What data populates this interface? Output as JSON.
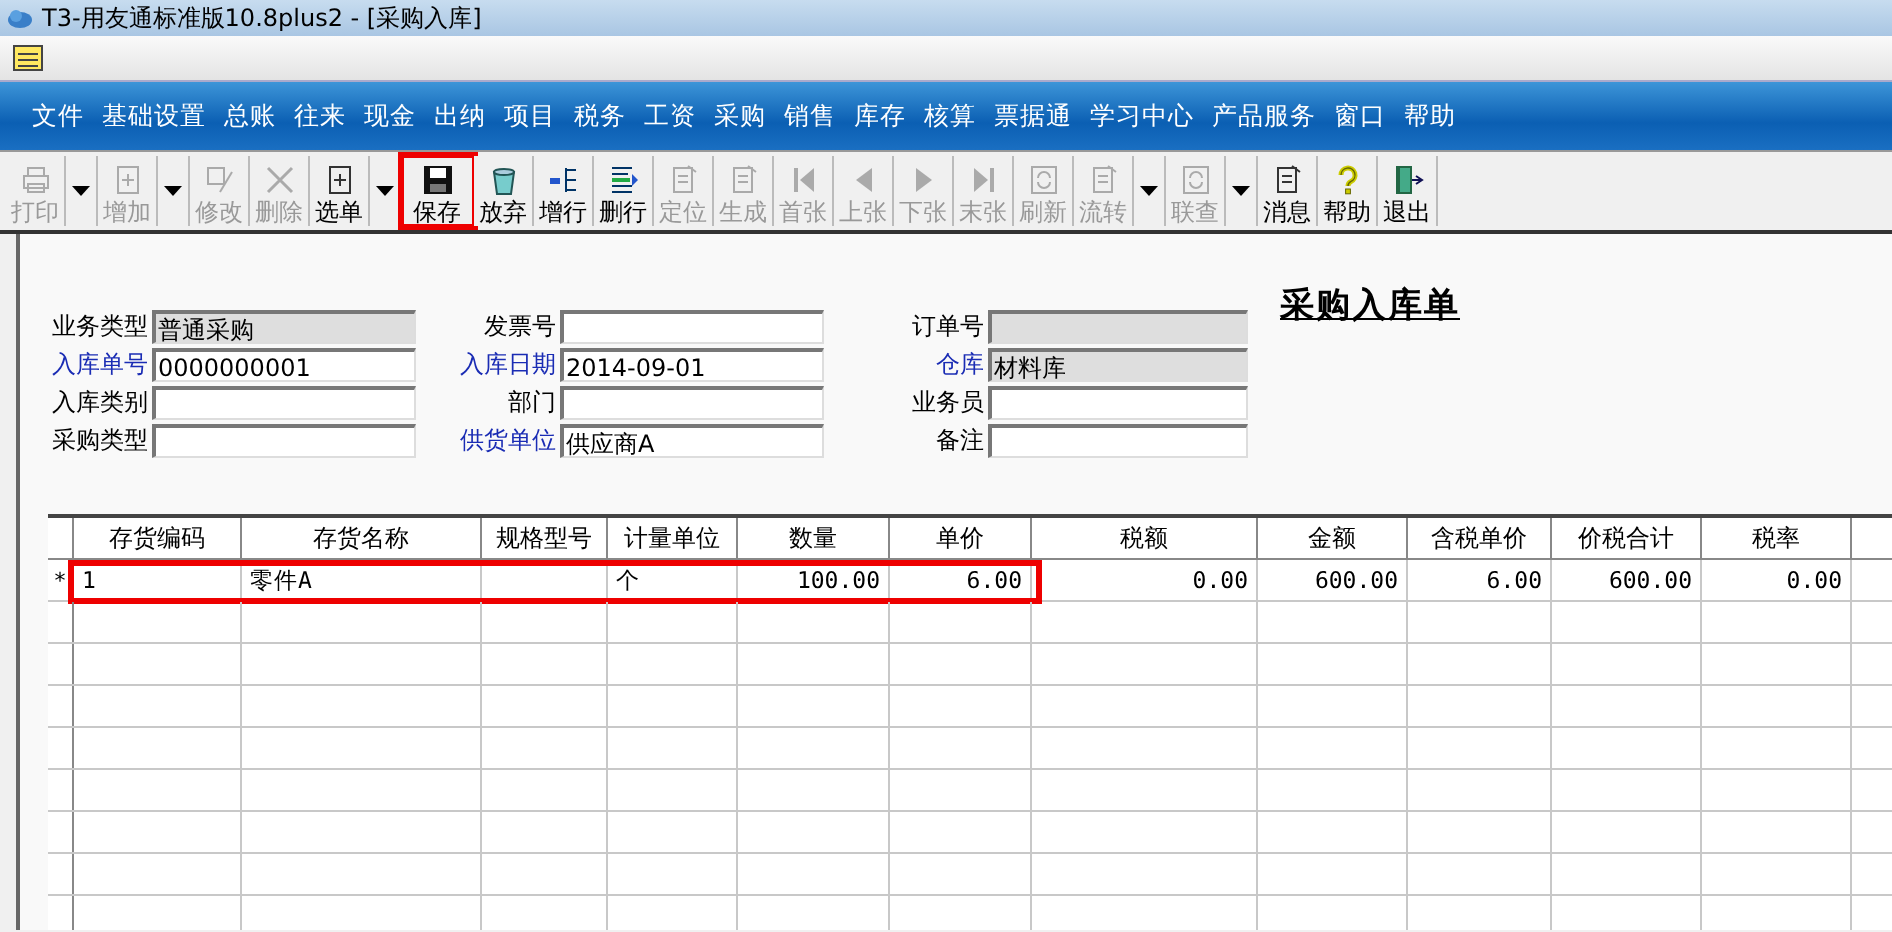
{
  "window": {
    "title": "T3-用友通标准版10.8plus2 - [采购入库]"
  },
  "menu": [
    "文件",
    "基础设置",
    "总账",
    "往来",
    "现金",
    "出纳",
    "项目",
    "税务",
    "工资",
    "采购",
    "销售",
    "库存",
    "核算",
    "票据通",
    "学习中心",
    "产品服务",
    "窗口",
    "帮助"
  ],
  "toolbar": [
    {
      "kind": "button",
      "label": "打印",
      "disabled": true,
      "highlighted": false
    },
    {
      "kind": "dropdown",
      "disabled": false
    },
    {
      "kind": "button",
      "label": "增加",
      "disabled": true,
      "highlighted": false
    },
    {
      "kind": "dropdown",
      "disabled": false
    },
    {
      "kind": "button",
      "label": "修改",
      "disabled": true,
      "highlighted": false
    },
    {
      "kind": "button",
      "label": "删除",
      "disabled": true,
      "highlighted": false
    },
    {
      "kind": "button",
      "label": "选单",
      "disabled": false,
      "highlighted": false
    },
    {
      "kind": "dropdown",
      "disabled": false
    },
    {
      "kind": "button",
      "label": "保存",
      "disabled": false,
      "highlighted": true
    },
    {
      "kind": "button",
      "label": "放弃",
      "disabled": false,
      "highlighted": false
    },
    {
      "kind": "button",
      "label": "增行",
      "disabled": false,
      "highlighted": false
    },
    {
      "kind": "button",
      "label": "删行",
      "disabled": false,
      "highlighted": false
    },
    {
      "kind": "button",
      "label": "定位",
      "disabled": true,
      "highlighted": false
    },
    {
      "kind": "button",
      "label": "生成",
      "disabled": true,
      "highlighted": false
    },
    {
      "kind": "button",
      "label": "首张",
      "disabled": true,
      "highlighted": false
    },
    {
      "kind": "button",
      "label": "上张",
      "disabled": true,
      "highlighted": false
    },
    {
      "kind": "button",
      "label": "下张",
      "disabled": true,
      "highlighted": false
    },
    {
      "kind": "button",
      "label": "末张",
      "disabled": true,
      "highlighted": false
    },
    {
      "kind": "button",
      "label": "刷新",
      "disabled": true,
      "highlighted": false
    },
    {
      "kind": "button",
      "label": "流转",
      "disabled": true,
      "highlighted": false
    },
    {
      "kind": "dropdown",
      "disabled": false
    },
    {
      "kind": "button",
      "label": "联查",
      "disabled": true,
      "highlighted": false
    },
    {
      "kind": "dropdown",
      "disabled": false
    },
    {
      "kind": "button",
      "label": "消息",
      "disabled": false,
      "highlighted": false
    },
    {
      "kind": "button",
      "label": "帮助",
      "disabled": false,
      "highlighted": false
    },
    {
      "kind": "button",
      "label": "退出",
      "disabled": false,
      "highlighted": false
    }
  ],
  "form": {
    "title": "采购入库单",
    "fields": [
      {
        "label": "业务类型",
        "value": "普通采购",
        "required": false,
        "readonly": true
      },
      {
        "label": "发票号",
        "required": false,
        "readonly": false
      },
      {
        "label": "订单号",
        "required": false,
        "readonly": true
      },
      {
        "label": "入库单号",
        "value": "0000000001",
        "required": true,
        "readonly": false
      },
      {
        "label": "入库日期",
        "value": "2014-09-01",
        "required": true,
        "readonly": false
      },
      {
        "label": "仓库",
        "value": "材料库",
        "required": true,
        "readonly": true
      },
      {
        "label": "入库类别",
        "required": false,
        "readonly": false
      },
      {
        "label": "部门",
        "required": false,
        "readonly": false
      },
      {
        "label": "业务员",
        "required": false,
        "readonly": false
      },
      {
        "label": "采购类型",
        "required": false,
        "readonly": false
      },
      {
        "label": "供货单位",
        "value": "供应商A",
        "required": true,
        "readonly": false
      },
      {
        "label": "备注",
        "required": false,
        "readonly": false
      }
    ]
  },
  "table": {
    "columns": [
      "存货编码",
      "存货名称",
      "规格型号",
      "计量单位",
      "数量",
      "单价",
      "税额",
      "金额",
      "含税单价",
      "价税合计",
      "税率"
    ],
    "rows": [
      {
        "marker": "*",
        "highlighted": true,
        "cells": [
          "1",
          "零件A",
          "",
          "个",
          "100.00",
          "6.00",
          "0.00",
          "600.00",
          "6.00",
          "600.00",
          "0.00"
        ]
      }
    ]
  }
}
